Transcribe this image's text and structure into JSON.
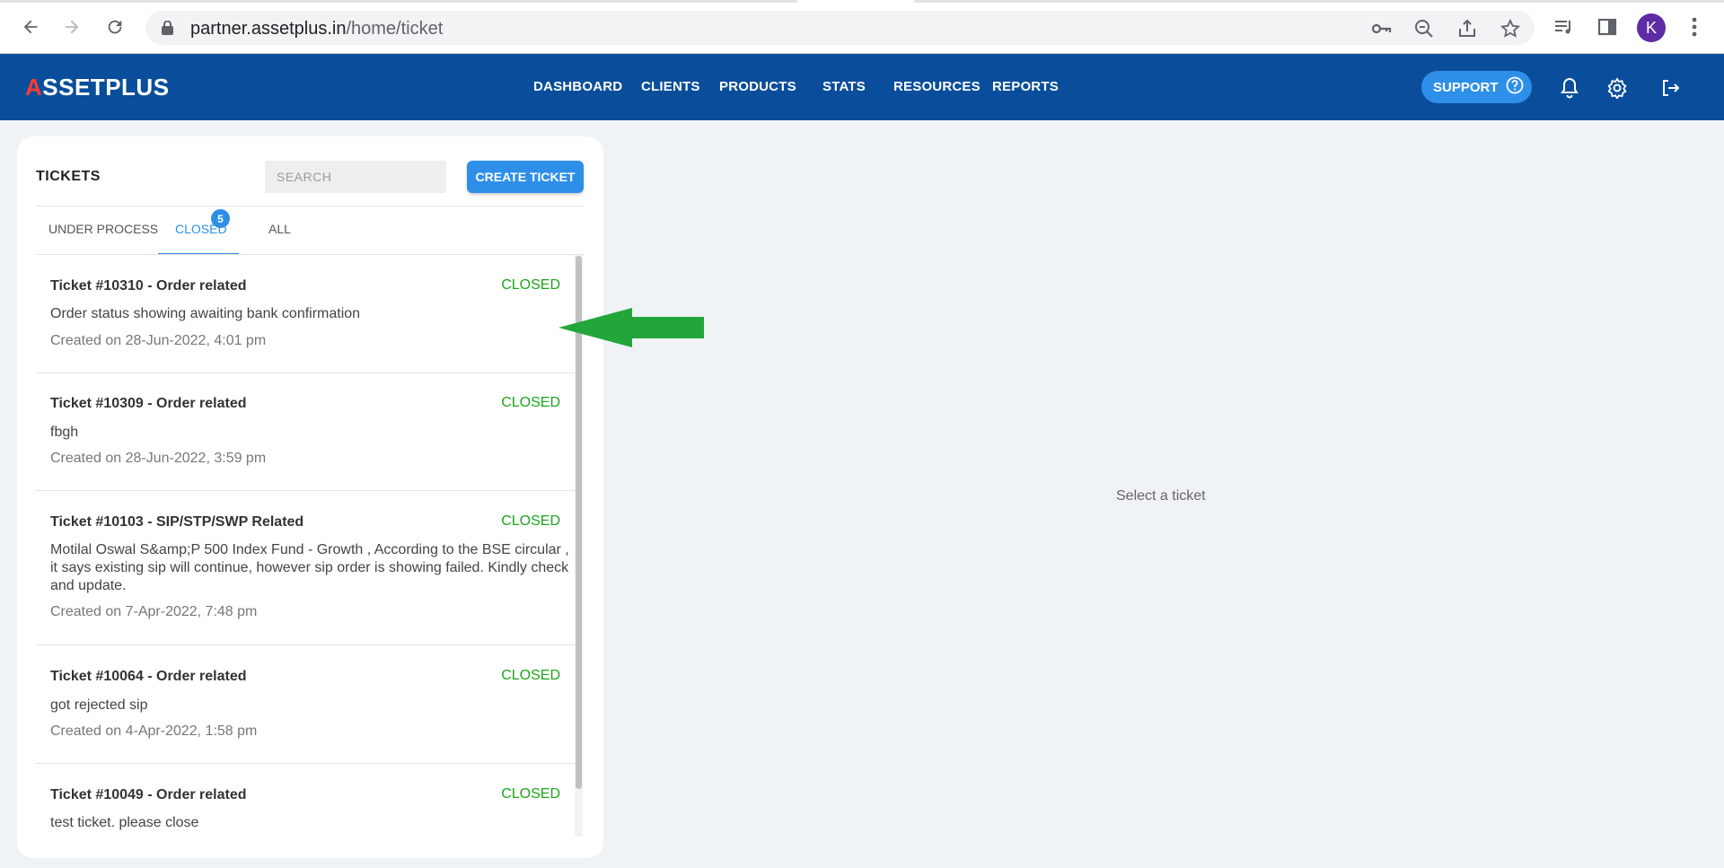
{
  "browser": {
    "url_host": "partner.assetplus.in",
    "url_path": "/home/ticket",
    "avatar_letter": "K",
    "icons": [
      "back-icon",
      "forward-icon",
      "reload-icon",
      "lock-icon",
      "key-icon",
      "zoom-out-icon",
      "share-icon",
      "star-icon",
      "media-icon",
      "sidebar-icon",
      "menu-icon"
    ]
  },
  "header": {
    "logo_accent": "A",
    "logo_rest": "SSETPLUS",
    "nav": [
      "DASHBOARD",
      "CLIENTS",
      "PRODUCTS",
      "STATS",
      "RESOURCES",
      "REPORTS"
    ],
    "support_label": "SUPPORT",
    "brand_color": "#0a4e9b",
    "accent_color": "#2e8fe8"
  },
  "tickets": {
    "title": "TICKETS",
    "search_placeholder": "SEARCH",
    "create_label": "CREATE TICKET",
    "tabs": [
      "UNDER PROCESS",
      "CLOSED",
      "ALL"
    ],
    "active_tab": "CLOSED",
    "closed_count": "5",
    "items": [
      {
        "title": "Ticket #10310 - Order related",
        "status": "CLOSED",
        "desc": "Order status showing awaiting bank confirmation",
        "date": "Created on 28-Jun-2022, 4:01 pm"
      },
      {
        "title": "Ticket #10309 - Order related",
        "status": "CLOSED",
        "desc": "fbgh",
        "date": "Created on 28-Jun-2022, 3:59 pm"
      },
      {
        "title": "Ticket #10103 - SIP/STP/SWP Related",
        "status": "CLOSED",
        "desc": "Motilal Oswal S&amp;P 500 Index Fund - Growth , According to the BSE circular , it says existing sip will continue, however sip order is showing failed. Kindly check and update.",
        "date": "Created on 7-Apr-2022, 7:48 pm"
      },
      {
        "title": "Ticket #10064 - Order related",
        "status": "CLOSED",
        "desc": "got rejected sip",
        "date": "Created on 4-Apr-2022, 1:58 pm"
      },
      {
        "title": "Ticket #10049 - Order related",
        "status": "CLOSED",
        "desc": "test ticket. please close",
        "date": ""
      }
    ],
    "status_color": "#1aa61a"
  },
  "detail": {
    "empty_message": "Select a ticket"
  },
  "annotation": {
    "arrow_color": "#22a63a"
  }
}
